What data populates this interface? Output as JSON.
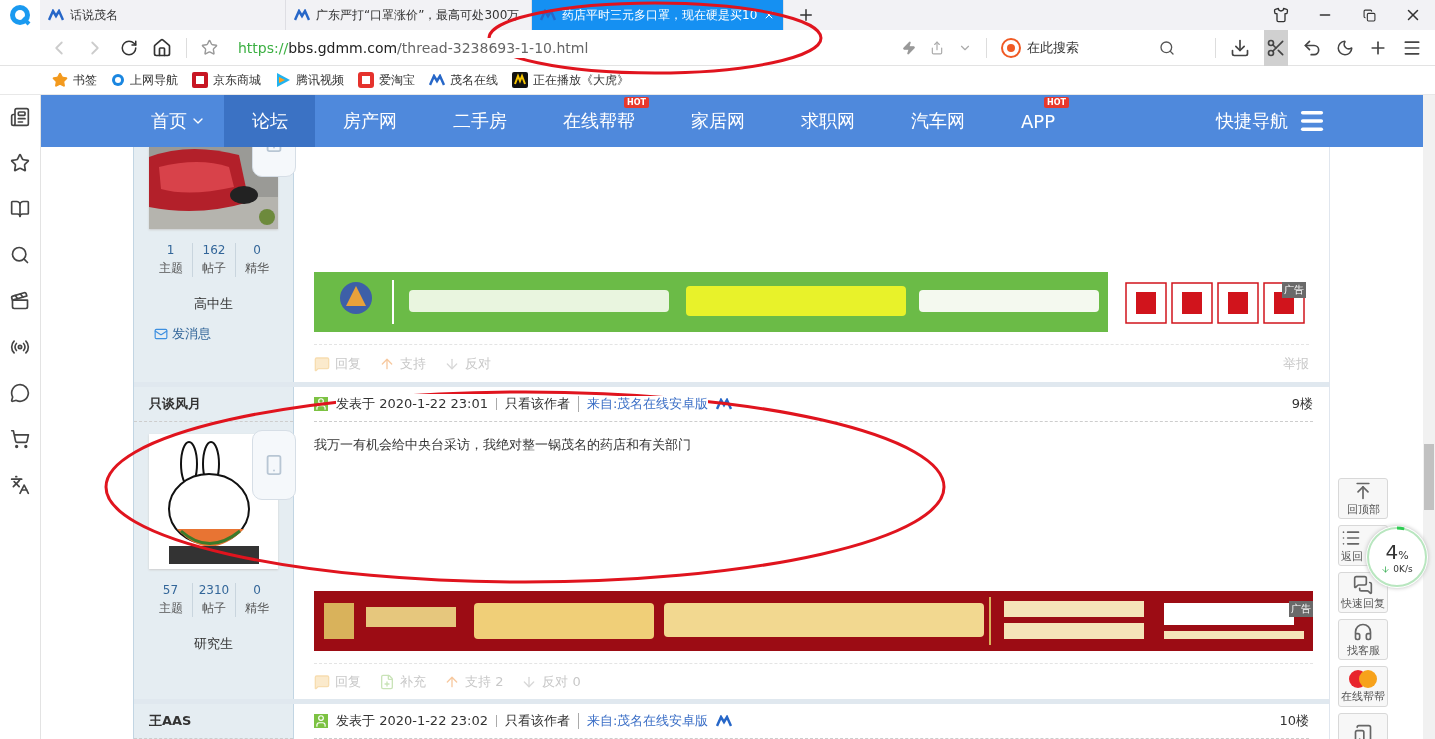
{
  "browser": {
    "tabs": [
      {
        "title": "话说茂名",
        "selected": false
      },
      {
        "title": "广东严打“口罩涨价”，最高可处300万",
        "selected": false
      },
      {
        "title": "药店平时三元多口罩，现在硬是买10",
        "selected": true
      }
    ],
    "url": {
      "scheme": "https://",
      "host": "bbs.gdmm.com",
      "path": "/thread-3238693-1-10.html"
    },
    "search": {
      "placeholder": "在此搜索"
    },
    "bookmarks": [
      {
        "label": "书签",
        "kind": "star"
      },
      {
        "label": "上网导航",
        "kind": "ie"
      },
      {
        "label": "京东商城",
        "kind": "jd"
      },
      {
        "label": "腾讯视频",
        "kind": "video"
      },
      {
        "label": "爱淘宝",
        "kind": "taobao"
      },
      {
        "label": "茂名在线",
        "kind": "gdmm"
      },
      {
        "label": "正在播放《大虎》",
        "kind": "player"
      }
    ]
  },
  "nav": {
    "items": [
      {
        "label": "首页",
        "selected": false,
        "dropdown": true
      },
      {
        "label": "论坛",
        "selected": true
      },
      {
        "label": "房产网",
        "selected": false
      },
      {
        "label": "二手房",
        "selected": false
      },
      {
        "label": "在线帮帮",
        "selected": false,
        "badge": "HOT"
      },
      {
        "label": "家居网",
        "selected": false
      },
      {
        "label": "求职网",
        "selected": false
      },
      {
        "label": "汽车网",
        "selected": false
      },
      {
        "label": "APP",
        "selected": false,
        "badge": "HOT"
      }
    ],
    "quick_nav": "快捷导航"
  },
  "posts": [
    {
      "avatar": {
        "kind": "car"
      },
      "stats": [
        {
          "value": "1",
          "label": "主题"
        },
        {
          "value": "162",
          "label": "帖子"
        },
        {
          "value": "0",
          "label": "精华"
        }
      ],
      "rank": "高中生",
      "message_link": "发消息",
      "ad": {
        "kind": "recruit",
        "label": "广告"
      },
      "actions": [
        {
          "label": "回复",
          "kind": "reply"
        },
        {
          "label": "支持",
          "kind": "up"
        },
        {
          "label": "反对",
          "kind": "down"
        }
      ],
      "report": "举报"
    },
    {
      "author": "只谈风月",
      "posted": "发表于 2020-1-22 23:01",
      "author_only": "只看该作者",
      "source": "来自:茂名在线安卓版",
      "floor": "9楼",
      "content": "我万一有机会给中央台采访，我绝对整一锅茂名的药店和有关部门",
      "avatar": {
        "kind": "rabbit"
      },
      "stats": [
        {
          "value": "57",
          "label": "主题"
        },
        {
          "value": "2310",
          "label": "帖子"
        },
        {
          "value": "0",
          "label": "精华"
        }
      ],
      "rank": "研究生",
      "ad": {
        "kind": "property",
        "label": "广告"
      },
      "actions": [
        {
          "label": "回复",
          "kind": "reply"
        },
        {
          "label": "补充",
          "kind": "add"
        },
        {
          "label": "支持 2",
          "kind": "up"
        },
        {
          "label": "反对 0",
          "kind": "down"
        }
      ]
    },
    {
      "author": "王AAS",
      "posted": "发表于 2020-1-22 23:02",
      "author_only": "只看该作者",
      "source": "来自:茂名在线安卓版",
      "floor": "10楼"
    }
  ],
  "side_tools": [
    {
      "label": "回顶部",
      "kind": "top",
      "covered": false
    },
    {
      "label": "返回",
      "kind": "list",
      "covered": true
    },
    {
      "label": "快速回复",
      "kind": "reply",
      "covered": false
    },
    {
      "label": "找客服",
      "kind": "service",
      "covered": false
    },
    {
      "label": "在线帮帮",
      "kind": "help",
      "covered": false
    },
    {
      "kind": "app",
      "covered": false
    }
  ],
  "speed": {
    "percent": "4",
    "unit": "%",
    "rate": "0K/s"
  }
}
